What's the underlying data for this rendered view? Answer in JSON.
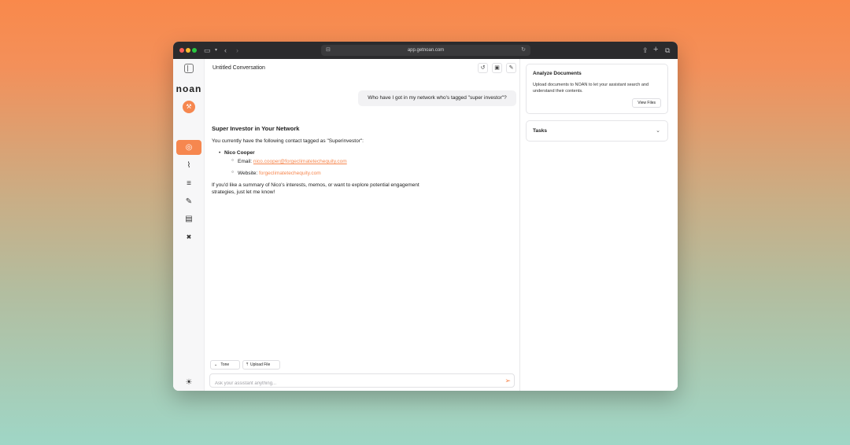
{
  "browser": {
    "url": "app.getnoan.com"
  },
  "sidebar": {
    "logo_text": "noan",
    "avatar_initials": "⚒",
    "items": [
      {
        "name": "assistant-icon",
        "glyph": "◎"
      },
      {
        "name": "activity-icon",
        "glyph": "⌇"
      },
      {
        "name": "layers-icon",
        "glyph": "≡"
      },
      {
        "name": "pencil-icon",
        "glyph": "✎"
      },
      {
        "name": "book-icon",
        "glyph": "▤"
      },
      {
        "name": "network-icon",
        "glyph": "✖"
      }
    ],
    "bottom": [
      {
        "name": "lightbulb-icon",
        "glyph": "☀"
      },
      {
        "name": "user-icon",
        "glyph": "☺"
      }
    ]
  },
  "conversation": {
    "title": "Untitled Conversation",
    "user_message": "Who have I got in my network who's tagged \"super investor\"?",
    "answer": {
      "heading": "Super Investor in Your Network",
      "intro": "You currently have the following contact tagged as \"Superinvestor\":",
      "contact_name": "Nico Cooper",
      "email_label": "Email: ",
      "email_value": "nico.cooper@forgeclimatetechequity.com",
      "website_label": "Website: ",
      "website_value": "forgeclimatetechequity.com",
      "closing": "If you'd like a summary of Nico's interests, memos, or want to explore potential engagement strategies, just let me know!"
    }
  },
  "composer": {
    "tone_label": "Tone",
    "upload_label": "Upload File",
    "placeholder": "Ask your assistant anything..."
  },
  "right_panel": {
    "analyze": {
      "title": "Analyze Documents",
      "description": "Upload documents to NOAN to let your assistant search and understand their contents.",
      "button_label": "View Files"
    },
    "tasks": {
      "title": "Tasks"
    }
  },
  "colors": {
    "accent": "#f6874f"
  }
}
